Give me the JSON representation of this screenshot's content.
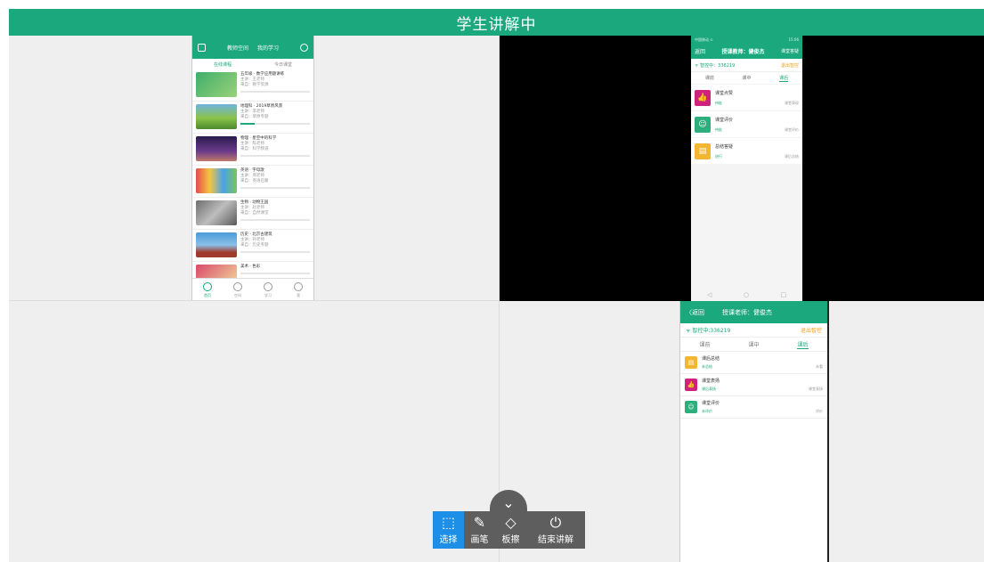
{
  "title": "学生讲解中",
  "phone1": {
    "tabs": [
      "教师空间",
      "我的学习"
    ],
    "subtabs": [
      "在线课程",
      "今日课堂"
    ],
    "courses": [
      {
        "title": "五年级 · 数学应用题讲练",
        "meta1": "主讲：王老师",
        "meta2": "来自：教学资源",
        "progress": 0.0,
        "pct": "0%"
      },
      {
        "title": "地理科 · 2019草原风景",
        "meta1": "主讲：李老师",
        "meta2": "来自：草原专题",
        "progress": 0.2,
        "pct": "20%"
      },
      {
        "title": "物理 · 星空中的科学",
        "meta1": "主讲：陈老师",
        "meta2": "来自：科学频道",
        "progress": 0.0,
        "pct": "0%"
      },
      {
        "title": "英语 · 字母歌",
        "meta1": "主讲：周老师",
        "meta2": "来自：英语启蒙",
        "progress": 0.0,
        "pct": "0%"
      },
      {
        "title": "生物 · 动物王国",
        "meta1": "主讲：赵老师",
        "meta2": "来自：自然课堂",
        "progress": 0.0,
        "pct": "0%"
      },
      {
        "title": "历史 · 北京古建筑",
        "meta1": "主讲：孙老师",
        "meta2": "来自：历史专题",
        "progress": 0.0,
        "pct": "0%"
      },
      {
        "title": "美术 · 色彩",
        "meta1": "",
        "meta2": "",
        "progress": 0.0,
        "pct": ""
      }
    ],
    "nav": [
      "首页",
      "空间",
      "学习",
      "我"
    ]
  },
  "phone2": {
    "status_left": "中国移动 ⊙",
    "status_right": "15:06",
    "back": "返回",
    "title": "授课教师：健俊杰",
    "right": "课堂答疑",
    "info_left": "ᯤ 智控中：336219",
    "info_right": "退出智控",
    "tabs": [
      "课前",
      "课中",
      "课后"
    ],
    "activities": [
      {
        "name": "课堂点赞",
        "status": "待批",
        "note": "课堂表现",
        "icon": "👍",
        "color": "#d0217d"
      },
      {
        "name": "课堂评价",
        "status": "待批",
        "note": "课堂评价",
        "icon": "☺",
        "color": "#2fae7d"
      },
      {
        "name": "总结答疑",
        "status": "进行",
        "note": "课后总结",
        "icon": "▤",
        "color": "#f2b631"
      }
    ],
    "nav": [
      "◁",
      "○",
      "□"
    ]
  },
  "phone3": {
    "back": "〈返回",
    "title": "授课老师：健俊杰",
    "info_left": "ᯤ 智控中:336219",
    "info_right": "退出智控",
    "tabs": [
      "课前",
      "课中",
      "课后"
    ],
    "activities": [
      {
        "name": "课后总结",
        "status": "未总结",
        "note": "未看",
        "icon": "▤",
        "color": "#f2b631"
      },
      {
        "name": "课堂表扬",
        "status": "课后表扬",
        "note": "课堂表扬",
        "icon": "👍",
        "color": "#d0217d"
      },
      {
        "name": "课堂评价",
        "status": "未评价",
        "note": "评价",
        "icon": "☺",
        "color": "#2fae7d"
      }
    ]
  },
  "toolbar": {
    "tools": [
      {
        "label": "选择",
        "icon": "⬚",
        "name": "select-tool",
        "active": true
      },
      {
        "label": "画笔",
        "icon": "✎",
        "name": "pen-tool",
        "active": false
      },
      {
        "label": "板擦",
        "icon": "◇",
        "name": "eraser-tool",
        "active": false
      },
      {
        "label": "结束讲解",
        "icon": "⏻",
        "name": "end-explain-tool",
        "active": false
      }
    ],
    "collapse_icon": "⌄"
  }
}
